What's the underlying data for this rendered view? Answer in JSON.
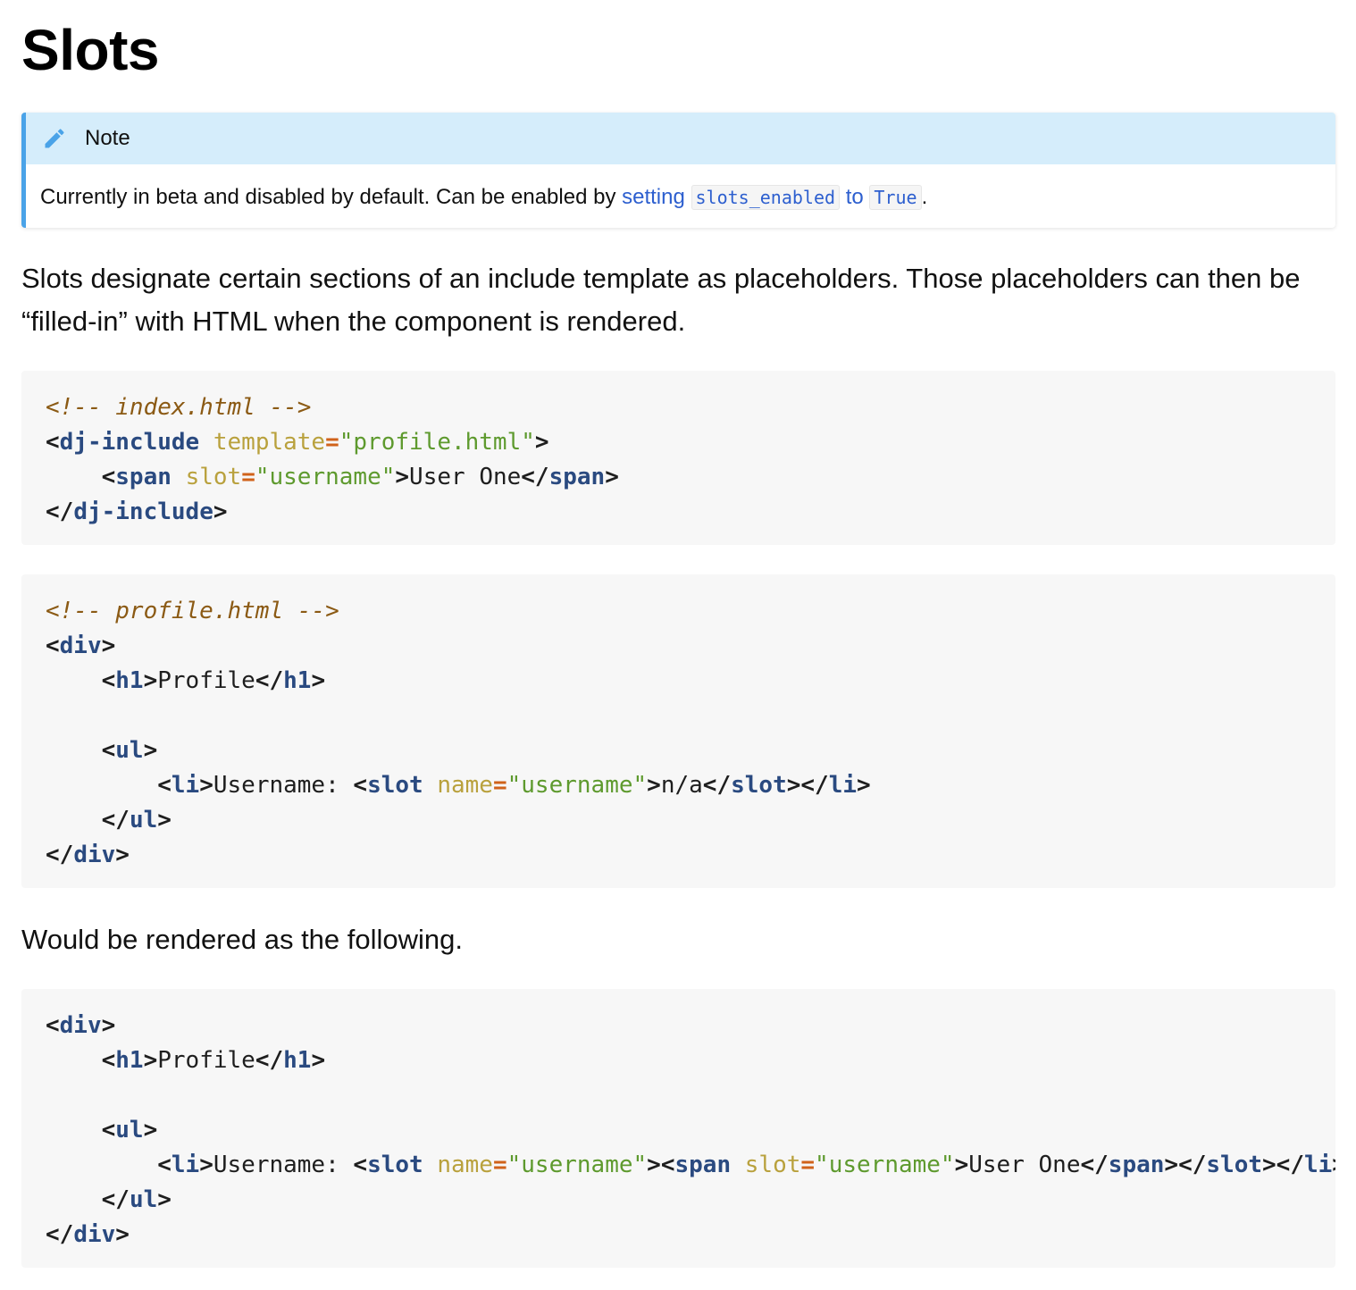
{
  "page": {
    "title": "Slots"
  },
  "note": {
    "icon": "pencil-icon",
    "title": "Note",
    "body_prefix": "Currently in beta and disabled by default. Can be enabled by ",
    "link_setting": "setting",
    "code_setting_name": "slots_enabled",
    "link_to": "to",
    "code_value": "True",
    "body_suffix": ".",
    "accent_color": "#4aa3e8",
    "header_bg": "#d5edfb"
  },
  "intro": {
    "text": "Slots designate certain sections of an include template as placeholders. Those placeholders can then be “filled-in” with HTML when the component is rendered."
  },
  "code_blocks": [
    {
      "lines": [
        [
          [
            "c",
            "<!-- index.html -->"
          ]
        ],
        [
          [
            "p",
            "<"
          ],
          [
            "t",
            "dj-include"
          ],
          [
            "x",
            " "
          ],
          [
            "a",
            "template"
          ],
          [
            "e",
            "="
          ],
          [
            "s",
            "\"profile.html\""
          ],
          [
            "p",
            ">"
          ]
        ],
        [
          [
            "x",
            "    "
          ],
          [
            "p",
            "<"
          ],
          [
            "t",
            "span"
          ],
          [
            "x",
            " "
          ],
          [
            "a",
            "slot"
          ],
          [
            "e",
            "="
          ],
          [
            "s",
            "\"username\""
          ],
          [
            "p",
            ">"
          ],
          [
            "x",
            "User One"
          ],
          [
            "p",
            "</"
          ],
          [
            "t",
            "span"
          ],
          [
            "p",
            ">"
          ]
        ],
        [
          [
            "p",
            "</"
          ],
          [
            "t",
            "dj-include"
          ],
          [
            "p",
            ">"
          ]
        ]
      ]
    },
    {
      "lines": [
        [
          [
            "c",
            "<!-- profile.html -->"
          ]
        ],
        [
          [
            "p",
            "<"
          ],
          [
            "t",
            "div"
          ],
          [
            "p",
            ">"
          ]
        ],
        [
          [
            "x",
            "    "
          ],
          [
            "p",
            "<"
          ],
          [
            "t",
            "h1"
          ],
          [
            "p",
            ">"
          ],
          [
            "x",
            "Profile"
          ],
          [
            "p",
            "</"
          ],
          [
            "t",
            "h1"
          ],
          [
            "p",
            ">"
          ]
        ],
        [
          [
            "x",
            ""
          ]
        ],
        [
          [
            "x",
            "    "
          ],
          [
            "p",
            "<"
          ],
          [
            "t",
            "ul"
          ],
          [
            "p",
            ">"
          ]
        ],
        [
          [
            "x",
            "        "
          ],
          [
            "p",
            "<"
          ],
          [
            "t",
            "li"
          ],
          [
            "p",
            ">"
          ],
          [
            "x",
            "Username: "
          ],
          [
            "p",
            "<"
          ],
          [
            "t",
            "slot"
          ],
          [
            "x",
            " "
          ],
          [
            "a",
            "name"
          ],
          [
            "e",
            "="
          ],
          [
            "s",
            "\"username\""
          ],
          [
            "p",
            ">"
          ],
          [
            "x",
            "n/a"
          ],
          [
            "p",
            "</"
          ],
          [
            "t",
            "slot"
          ],
          [
            "p",
            "></"
          ],
          [
            "t",
            "li"
          ],
          [
            "p",
            ">"
          ]
        ],
        [
          [
            "x",
            "    "
          ],
          [
            "p",
            "</"
          ],
          [
            "t",
            "ul"
          ],
          [
            "p",
            ">"
          ]
        ],
        [
          [
            "p",
            "</"
          ],
          [
            "t",
            "div"
          ],
          [
            "p",
            ">"
          ]
        ]
      ]
    },
    {
      "lines": [
        [
          [
            "p",
            "<"
          ],
          [
            "t",
            "div"
          ],
          [
            "p",
            ">"
          ]
        ],
        [
          [
            "x",
            "    "
          ],
          [
            "p",
            "<"
          ],
          [
            "t",
            "h1"
          ],
          [
            "p",
            ">"
          ],
          [
            "x",
            "Profile"
          ],
          [
            "p",
            "</"
          ],
          [
            "t",
            "h1"
          ],
          [
            "p",
            ">"
          ]
        ],
        [
          [
            "x",
            ""
          ]
        ],
        [
          [
            "x",
            "    "
          ],
          [
            "p",
            "<"
          ],
          [
            "t",
            "ul"
          ],
          [
            "p",
            ">"
          ]
        ],
        [
          [
            "x",
            "        "
          ],
          [
            "p",
            "<"
          ],
          [
            "t",
            "li"
          ],
          [
            "p",
            ">"
          ],
          [
            "x",
            "Username: "
          ],
          [
            "p",
            "<"
          ],
          [
            "t",
            "slot"
          ],
          [
            "x",
            " "
          ],
          [
            "a",
            "name"
          ],
          [
            "e",
            "="
          ],
          [
            "s",
            "\"username\""
          ],
          [
            "p",
            "><"
          ],
          [
            "t",
            "span"
          ],
          [
            "x",
            " "
          ],
          [
            "a",
            "slot"
          ],
          [
            "e",
            "="
          ],
          [
            "s",
            "\"username\""
          ],
          [
            "p",
            ">"
          ],
          [
            "x",
            "User One"
          ],
          [
            "p",
            "</"
          ],
          [
            "t",
            "span"
          ],
          [
            "p",
            "></"
          ],
          [
            "t",
            "slot"
          ],
          [
            "p",
            "></"
          ],
          [
            "t",
            "li"
          ],
          [
            "p",
            ">"
          ]
        ],
        [
          [
            "x",
            "    "
          ],
          [
            "p",
            "</"
          ],
          [
            "t",
            "ul"
          ],
          [
            "p",
            ">"
          ]
        ],
        [
          [
            "p",
            "</"
          ],
          [
            "t",
            "div"
          ],
          [
            "p",
            ">"
          ]
        ]
      ]
    }
  ],
  "rendered_note": {
    "text": "Would be rendered as the following."
  },
  "syntax_colors": {
    "comment": "#8b5a14",
    "tag": "#2a4a80",
    "attribute": "#b9a13d",
    "equals": "#d0621a",
    "string": "#5e9a2e"
  }
}
